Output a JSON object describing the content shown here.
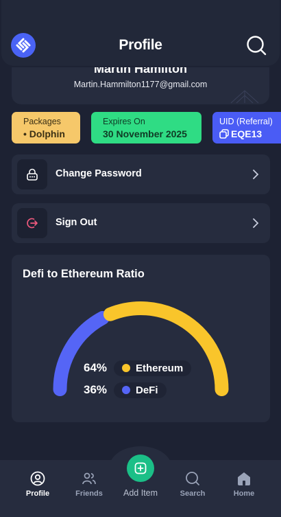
{
  "header": {
    "title": "Profile"
  },
  "user": {
    "name": "Martin Hamilton",
    "email": "Martin.Hammilton1177@gmail.com"
  },
  "chips": {
    "package": {
      "label": "Packages",
      "value": "• Dolphin"
    },
    "expires": {
      "label": "Expires On",
      "value": "30 November 2025"
    },
    "uid": {
      "label": "UID (Referral)",
      "value": "EQE13"
    }
  },
  "menu": [
    {
      "label": "Change Password",
      "icon": "lock-icon"
    },
    {
      "label": "Sign Out",
      "icon": "sign-out-icon"
    }
  ],
  "chart": {
    "title": "Defi to Ethereum Ratio"
  },
  "chart_data": {
    "type": "pie",
    "title": "Defi to Ethereum Ratio",
    "categories": [
      "Ethereum",
      "DeFi"
    ],
    "values": [
      64,
      36
    ],
    "labels": [
      "64%",
      "36%"
    ],
    "colors": {
      "Ethereum": "#f9c52b",
      "DeFi": "#5565f6"
    }
  },
  "nav": {
    "items": [
      {
        "label": "Profile",
        "icon": "profile-icon",
        "active": true
      },
      {
        "label": "Friends",
        "icon": "friends-icon"
      },
      {
        "label": "Add Item",
        "icon": "add-icon"
      },
      {
        "label": "Search",
        "icon": "search-icon"
      },
      {
        "label": "Home",
        "icon": "home-icon"
      }
    ]
  },
  "colors": {
    "background": "#1d2233",
    "card": "#262c3e",
    "accent_green": "#1bbf87",
    "accent_blue": "#4a5cf5",
    "accent_yellow": "#f6c86a"
  }
}
